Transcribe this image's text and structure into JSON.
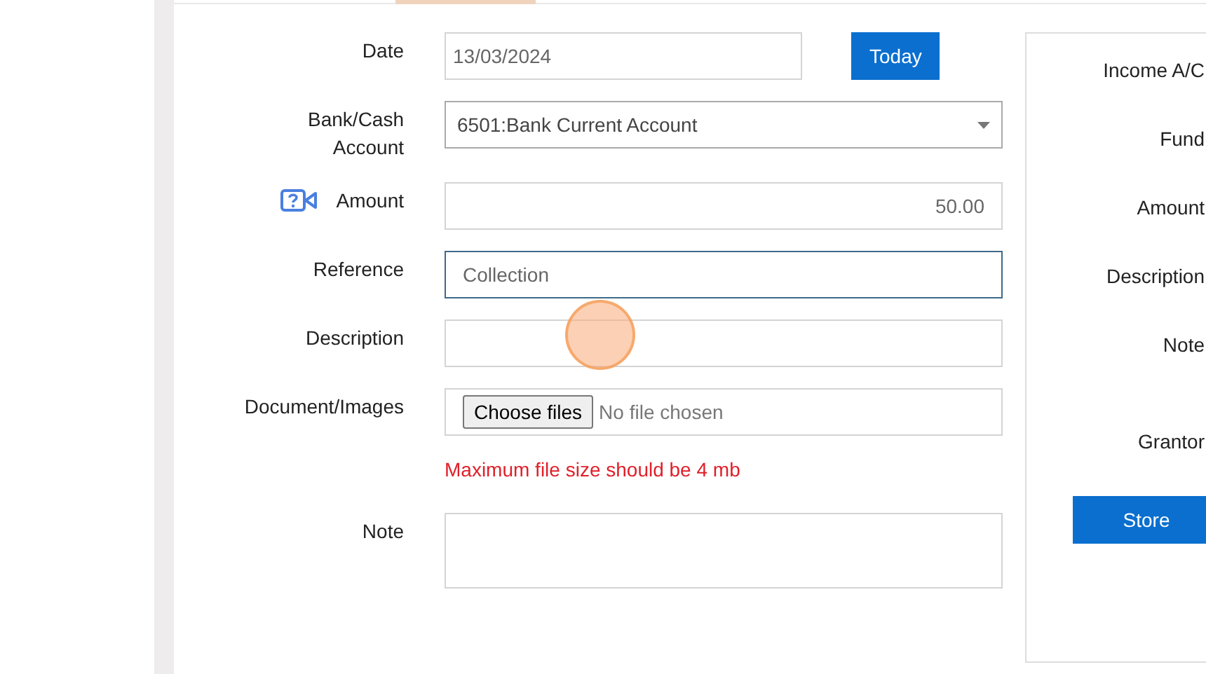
{
  "form": {
    "fields": [
      {
        "label": "Date",
        "kind": "date",
        "value": "13/03/2024",
        "button": "Today"
      },
      {
        "label": "Bank/Cash Account",
        "kind": "select",
        "value": "6501:Bank Current Account"
      },
      {
        "label": "Amount",
        "kind": "amount",
        "value": "50.00",
        "help_icon": true
      },
      {
        "label": "Reference",
        "kind": "text",
        "value": "Collection",
        "focused": true
      },
      {
        "label": "Description",
        "kind": "text",
        "focused": false
      },
      {
        "label": "Document/Images",
        "kind": "file",
        "button": "Choose files",
        "status": "No file chosen",
        "hint": "Maximum file size should be 4 mb"
      },
      {
        "label": "Note",
        "kind": "textarea"
      }
    ]
  },
  "side_panel": {
    "labels": [
      "Income A/C",
      "Fund",
      "Amount",
      "Description",
      "Note",
      "Grantor"
    ],
    "button": "Store"
  }
}
